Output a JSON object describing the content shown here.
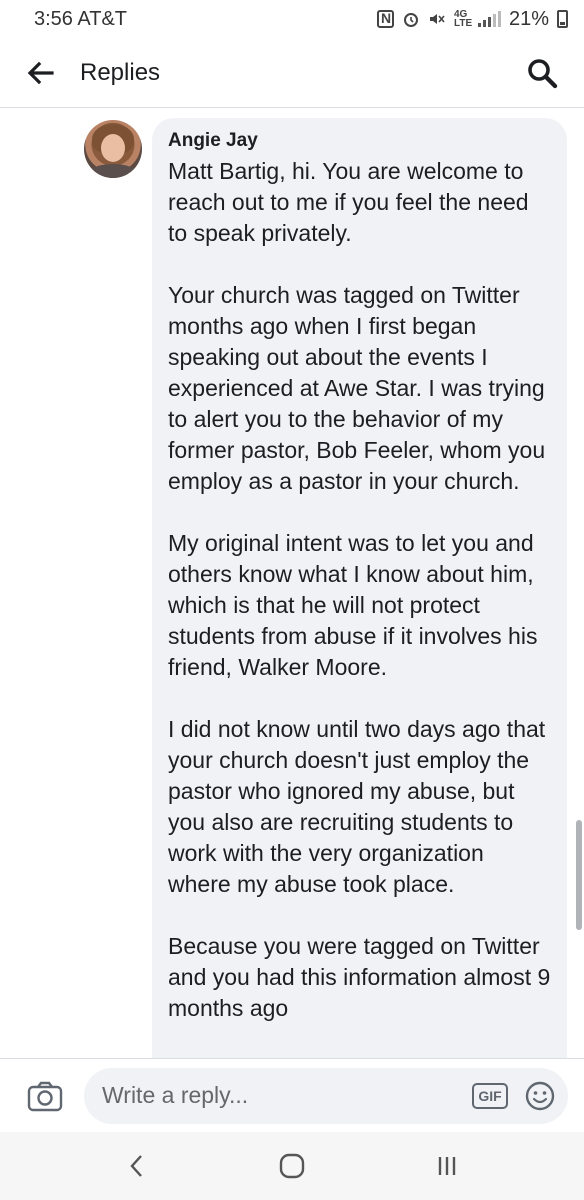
{
  "status_bar": {
    "time_carrier": "3:56 AT&T",
    "network": "4G LTE",
    "battery": "21%"
  },
  "header": {
    "title": "Replies"
  },
  "comment": {
    "author": "Angie Jay",
    "paragraphs": [
      "Matt Bartig, hi. You are welcome to reach out to me if you feel the need to speak privately.",
      "Your church was tagged on Twitter months ago when I first began speaking out about the events I experienced at Awe Star. I was trying to alert you to the behavior of my former pastor, Bob Feeler, whom you employ as a pastor in your church.",
      "My original intent was to let you and others know what I know about him, which is that he will not protect students from abuse if it involves his friend, Walker Moore.",
      "I did not know until two days ago that your church doesn't just employ the pastor who ignored my abuse, but you also are recruiting students to work with the very organization where my abuse took place.",
      "Because you were tagged on Twitter and you had this information almost 9 months ago"
    ]
  },
  "reply_bar": {
    "placeholder": "Write a reply...",
    "gif_label": "GIF"
  },
  "icons": {
    "back": "arrow-left-icon",
    "search": "search-icon",
    "camera": "camera-icon",
    "emoji": "smiley-icon",
    "nav_back": "chevron-left-icon",
    "nav_home": "home-icon",
    "nav_recents": "recents-icon"
  },
  "colors": {
    "bubble": "#f0f2f5",
    "text": "#1c1e21",
    "placeholder": "#65676b"
  }
}
